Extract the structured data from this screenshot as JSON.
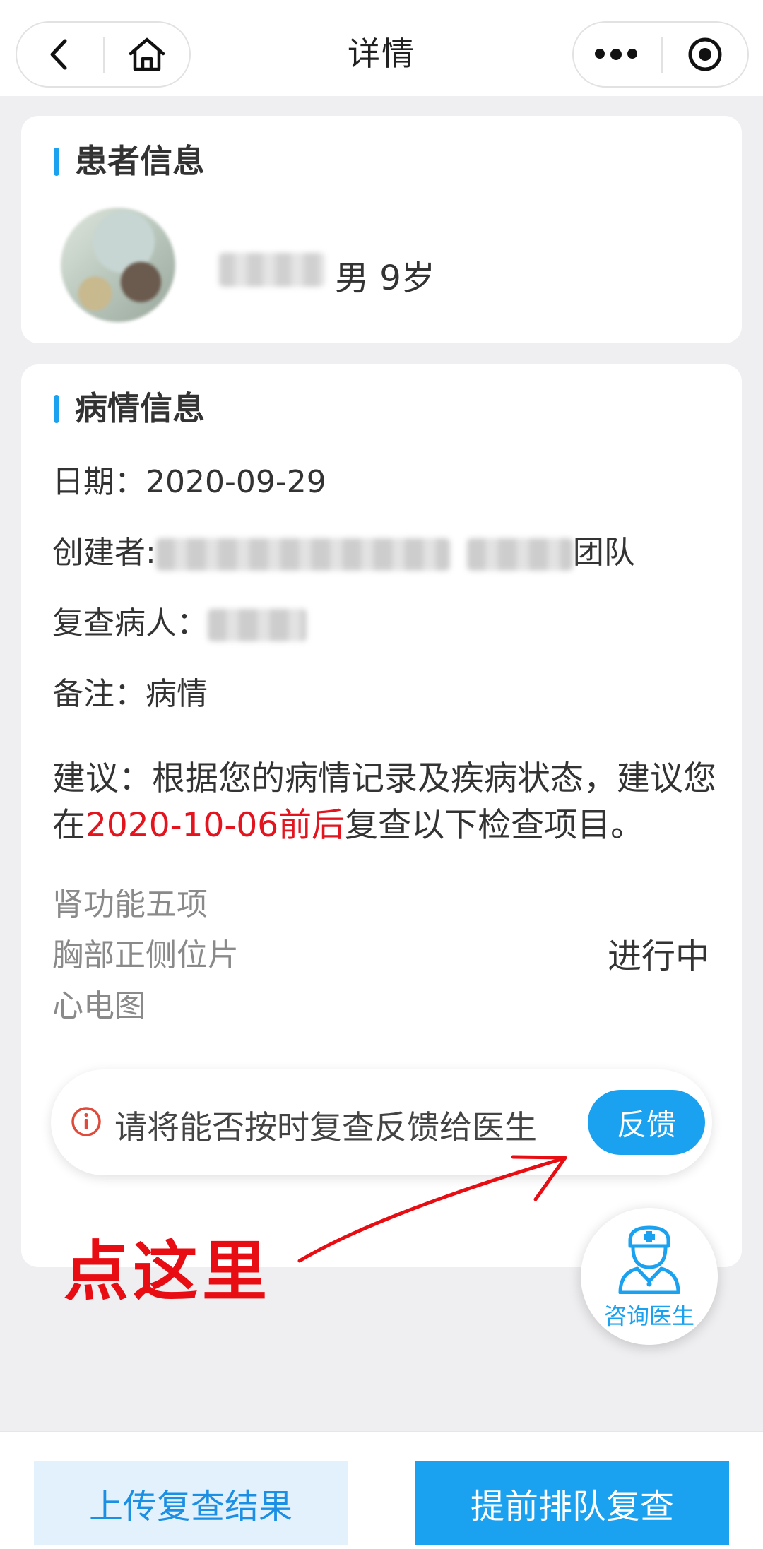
{
  "header": {
    "title": "详情",
    "back_icon": "back-arrow-icon",
    "home_icon": "home-icon",
    "more_icon": "more-dots-icon",
    "target_icon": "target-circle-icon"
  },
  "patient": {
    "section_title": "患者信息",
    "gender_age": "男 9岁"
  },
  "condition": {
    "section_title": "病情信息",
    "date": "日期：2020-09-29",
    "creator_label": "创建者:",
    "creator_suffix": "团队",
    "patient_label": "复查病人：",
    "remark": "备注：病情",
    "advice_prefix": "建议：根据您的病情记录及疾病状态，建议您在",
    "advice_date": "2020-10-06前后",
    "advice_suffix": "复查以下检查项目。",
    "check_items": [
      "肾功能五项",
      "胸部正侧位片",
      "心电图"
    ],
    "status": "进行中"
  },
  "feedback": {
    "prompt": "请将能否按时复查反馈给医生",
    "button": "反馈"
  },
  "annotation": {
    "text": "点这里"
  },
  "consult": {
    "label": "咨询医生"
  },
  "bottom": {
    "upload_label": "上传复查结果",
    "queue_label": "提前排队复查"
  },
  "colors": {
    "accent": "#1aa1ef",
    "highlight": "#e3141e",
    "background": "#efeff1"
  }
}
